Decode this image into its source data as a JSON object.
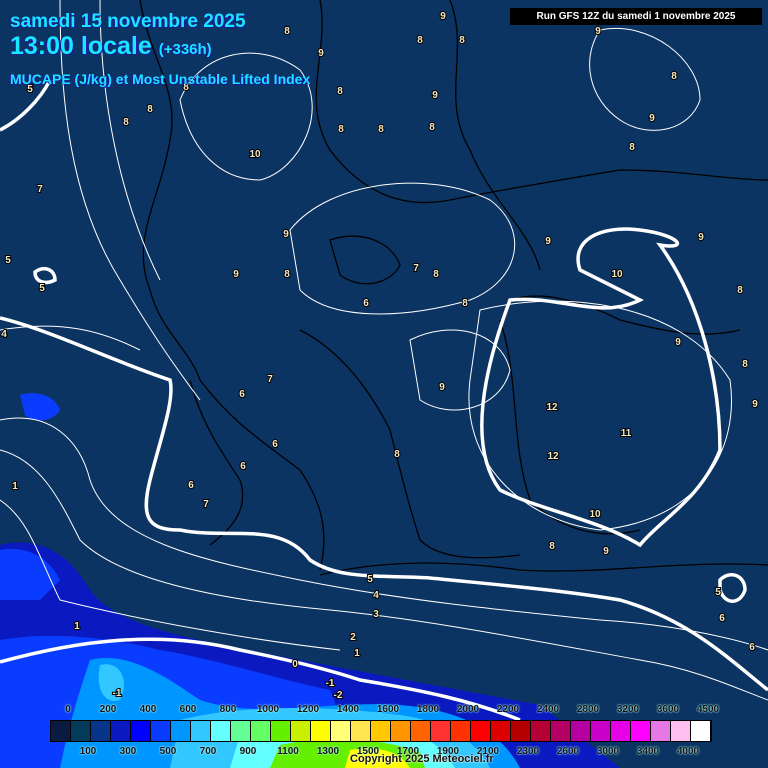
{
  "header": {
    "date": "samedi 15 novembre 2025",
    "time": "13:00 locale",
    "lead": "(+336h)",
    "parameter": "MUCAPE (J/kg) et Most Unstable Lifted Index",
    "run": "Run GFS 12Z du samedi 1 novembre 2025"
  },
  "colors": {
    "background": "#0b3462",
    "title": "#19e6ff",
    "contour": "#ffffff"
  },
  "legend": {
    "unit": "J/kg",
    "top_labels": [
      "0",
      "200",
      "400",
      "600",
      "800",
      "1000",
      "1200",
      "1400",
      "1600",
      "1800",
      "2000",
      "2200",
      "2400",
      "2800",
      "3200",
      "3600",
      "4500"
    ],
    "bottom_labels": [
      "100",
      "300",
      "500",
      "700",
      "900",
      "1100",
      "1300",
      "1500",
      "1700",
      "1900",
      "2100",
      "2300",
      "2600",
      "3000",
      "3400",
      "4000"
    ],
    "swatches": [
      "#0a1a40",
      "#063a5a",
      "#08358a",
      "#0a1ac0",
      "#0000ff",
      "#0a3cff",
      "#0096ff",
      "#32c8ff",
      "#64ffff",
      "#64ff96",
      "#64ff64",
      "#64f000",
      "#c8f000",
      "#ffff00",
      "#ffff78",
      "#ffe650",
      "#ffc800",
      "#ff9600",
      "#ff6400",
      "#ff3232",
      "#ff3200",
      "#ff0000",
      "#dc0000",
      "#b40000",
      "#b40032",
      "#b40064",
      "#b400a0",
      "#c800c8",
      "#e600e6",
      "#ff00ff",
      "#e678e6",
      "#ffbef0",
      "#ffffff"
    ]
  },
  "contour_labels": [
    "9",
    "9",
    "8",
    "8",
    "9",
    "8",
    "8",
    "5",
    "8",
    "8",
    "9",
    "8",
    "8",
    "9",
    "8",
    "8",
    "8",
    "8",
    "10",
    "7",
    "9",
    "9",
    "9",
    "5",
    "9",
    "8",
    "7",
    "8",
    "10",
    "5",
    "8",
    "6",
    "8",
    "4",
    "9",
    "8",
    "7",
    "9",
    "6",
    "9",
    "12",
    "11",
    "6",
    "8",
    "12",
    "6",
    "1",
    "6",
    "7",
    "10",
    "8",
    "9",
    "5",
    "4",
    "5",
    "3",
    "6",
    "1",
    "2",
    "1",
    "6",
    "0",
    "-1",
    "-1",
    "-2"
  ],
  "copyright": "Copyright 2025 Meteociel.fr"
}
